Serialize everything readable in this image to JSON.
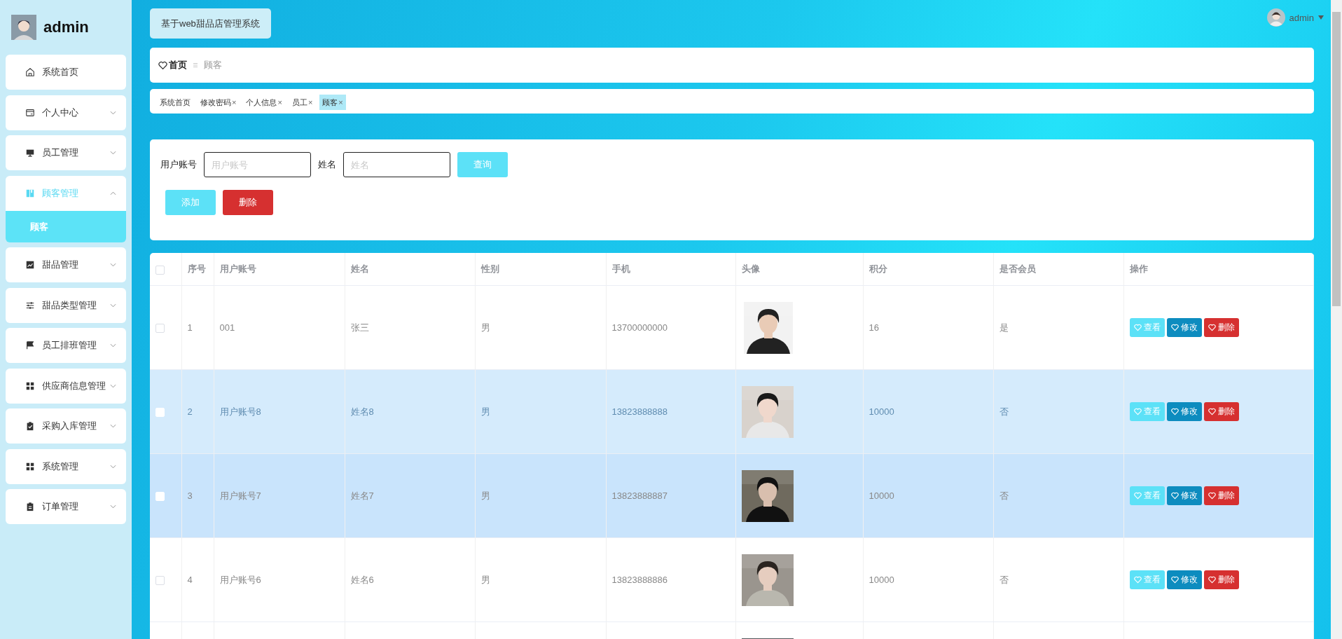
{
  "sidebar": {
    "title": "admin",
    "menu": [
      {
        "label": "系统首页",
        "selected": false
      },
      {
        "label": "个人中心",
        "expanded": false,
        "selected": false
      },
      {
        "label": "员工管理",
        "expanded": false,
        "selected": false
      },
      {
        "label": "顾客管理",
        "expanded": true,
        "selected": true,
        "children": [
          {
            "label": "顾客",
            "selected": true
          }
        ]
      },
      {
        "label": "甜品管理",
        "expanded": false,
        "selected": false
      },
      {
        "label": "甜品类型管理",
        "expanded": false,
        "selected": false
      },
      {
        "label": "员工排班管理",
        "expanded": false,
        "selected": false
      },
      {
        "label": "供应商信息管理",
        "expanded": false,
        "selected": false
      },
      {
        "label": "采购入库管理",
        "expanded": false,
        "selected": false
      },
      {
        "label": "系统管理",
        "expanded": false,
        "selected": false
      },
      {
        "label": "订单管理",
        "expanded": false,
        "selected": false
      }
    ]
  },
  "header": {
    "system_title": "基于web甜品店管理系统",
    "user": "admin"
  },
  "breadcrumb": [
    "首页",
    "顾客"
  ],
  "tags": [
    {
      "label": "系统首页",
      "selected": false
    },
    {
      "label": "修改密码",
      "close": "×",
      "selected": false
    },
    {
      "label": "个人信息",
      "close": "×",
      "selected": false
    },
    {
      "label": "员工",
      "close": "×",
      "selected": false
    },
    {
      "label": "顾客",
      "close": "×",
      "selected": true
    }
  ],
  "search": {
    "fields": [
      {
        "label": "用户账号",
        "placeholder": "用户账号"
      },
      {
        "label": "姓名",
        "placeholder": "姓名"
      }
    ],
    "buttons": [
      {
        "label": "查询",
        "kind": "query"
      }
    ]
  },
  "toolbar": [
    {
      "label": "添加",
      "kind": "add"
    },
    {
      "label": "删除",
      "kind": "delete"
    }
  ],
  "table": {
    "all_checked": false,
    "columns": [
      "序号",
      "用户账号",
      "姓名",
      "性别",
      "手机",
      "头像",
      "积分",
      "是否会员",
      "操作"
    ],
    "rows": [
      {
        "index": "1",
        "account": "001",
        "name": "张三",
        "gender": "男",
        "phone": "13700000000",
        "points": "16",
        "member": "是",
        "checked": false,
        "hovered": false,
        "striped": false,
        "actions": [
          {
            "label": "查看",
            "kind": "view"
          },
          {
            "label": "修改",
            "kind": "edit"
          },
          {
            "label": "删除",
            "kind": "delete"
          }
        ]
      },
      {
        "index": "2",
        "account": "用户账号8",
        "name": "姓名8",
        "gender": "男",
        "phone": "13823888888",
        "points": "10000",
        "member": "否",
        "checked": false,
        "hovered": true,
        "striped": false,
        "actions": [
          {
            "label": "查看",
            "kind": "view"
          },
          {
            "label": "修改",
            "kind": "edit"
          },
          {
            "label": "删除",
            "kind": "delete"
          }
        ]
      },
      {
        "index": "3",
        "account": "用户账号7",
        "name": "姓名7",
        "gender": "男",
        "phone": "13823888887",
        "points": "10000",
        "member": "否",
        "checked": false,
        "hovered": false,
        "striped": true,
        "actions": [
          {
            "label": "查看",
            "kind": "view"
          },
          {
            "label": "修改",
            "kind": "edit"
          },
          {
            "label": "删除",
            "kind": "delete"
          }
        ]
      },
      {
        "index": "4",
        "account": "用户账号6",
        "name": "姓名6",
        "gender": "男",
        "phone": "13823888886",
        "points": "10000",
        "member": "否",
        "checked": false,
        "hovered": false,
        "striped": false,
        "actions": [
          {
            "label": "查看",
            "kind": "view"
          },
          {
            "label": "修改",
            "kind": "edit"
          },
          {
            "label": "删除",
            "kind": "delete"
          }
        ]
      },
      {
        "hovered": false,
        "striped": false
      }
    ]
  }
}
